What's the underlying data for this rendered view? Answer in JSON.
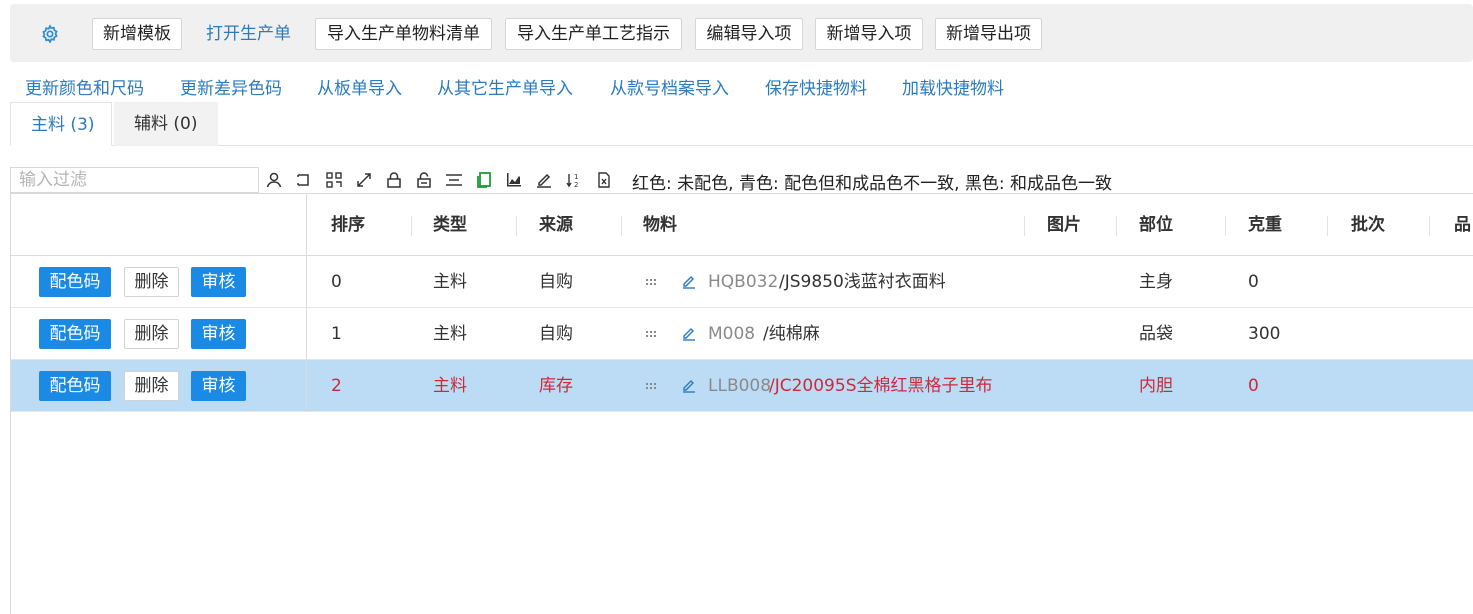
{
  "toolbar": {
    "gear_icon": "gear-icon",
    "buttons": [
      "新增模板",
      "打开生产单",
      "导入生产单物料清单",
      "导入生产单工艺指示",
      "编辑导入项",
      "新增导入项",
      "新增导出项"
    ]
  },
  "links": [
    "更新颜色和尺码",
    "更新差异色码",
    "从板单导入",
    "从其它生产单导入",
    "从款号档案导入",
    "保存快捷物料",
    "加载快捷物料"
  ],
  "tabs": [
    {
      "label": "主料 (3)",
      "active": true
    },
    {
      "label": "辅料 (0)",
      "active": false
    }
  ],
  "filter": {
    "placeholder": "输入过滤",
    "value": ""
  },
  "icon_bar": [
    "user-icon",
    "return-icon",
    "grid-icon",
    "expand-icon",
    "lock-icon",
    "unlock-icon",
    "columns-icon",
    "copy-icon",
    "chart-icon",
    "edit-icon",
    "sort-icon",
    "excel-icon"
  ],
  "legend": "红色: 未配色, 青色: 配色但和成品色不一致, 黑色: 和成品色一致",
  "colors": {
    "accent": "#1a8ae5",
    "link": "#2c7bbf",
    "warning_text": "#d0283a",
    "selected_row": "#bcdcf6"
  },
  "table": {
    "columns": [
      "排序",
      "类型",
      "来源",
      "物料",
      "图片",
      "部位",
      "克重",
      "批次",
      "品"
    ],
    "row_actions": [
      "配色码",
      "删除",
      "审核"
    ],
    "rows": [
      {
        "order": "0",
        "type": "主料",
        "source": "自购",
        "code": "HQB032",
        "name": "/JS9850浅蓝衬衣面料",
        "part": "主身",
        "weight": "0",
        "selected": false,
        "red": false
      },
      {
        "order": "1",
        "type": "主料",
        "source": "自购",
        "code": "M008",
        "name": "/纯棉麻",
        "part": "品袋",
        "weight": "300",
        "selected": false,
        "red": false
      },
      {
        "order": "2",
        "type": "主料",
        "source": "库存",
        "code": "LLB008",
        "name": "/JC20095S全棉红黑格子里布",
        "part": "内胆",
        "weight": "0",
        "selected": true,
        "red": true
      }
    ]
  }
}
